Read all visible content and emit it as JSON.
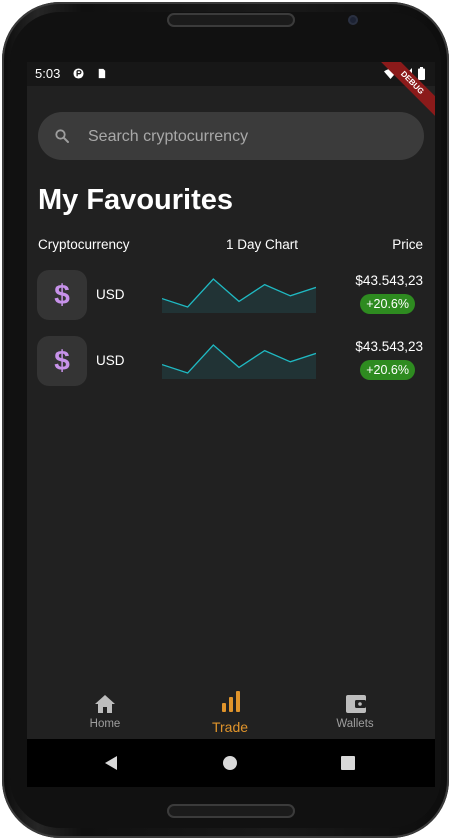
{
  "status_bar": {
    "time": "5:03",
    "debug_banner": "DEBUG"
  },
  "search": {
    "placeholder": "Search cryptocurrency"
  },
  "favourites": {
    "title": "My Favourites",
    "columns": {
      "crypto": "Cryptocurrency",
      "chart": "1 Day Chart",
      "price": "Price"
    },
    "items": [
      {
        "symbol": "$",
        "name": "USD",
        "price": "$43.543,23",
        "change": "+20.6%",
        "chart_values": [
          5,
          2,
          12,
          4,
          10,
          6,
          9
        ]
      },
      {
        "symbol": "$",
        "name": "USD",
        "price": "$43.543,23",
        "change": "+20.6%",
        "chart_values": [
          5,
          2,
          12,
          4,
          10,
          6,
          9
        ]
      }
    ]
  },
  "nav": {
    "items": [
      {
        "label": "Home",
        "icon": "home-icon",
        "active": false
      },
      {
        "label": "Trade",
        "icon": "bar-chart-icon",
        "active": true
      },
      {
        "label": "Wallets",
        "icon": "wallet-icon",
        "active": false
      }
    ]
  },
  "colors": {
    "accent": "#e0942b",
    "positive": "#2e8b20",
    "chart_line": "#1fb9c2",
    "coin_icon": "#c792ea"
  }
}
